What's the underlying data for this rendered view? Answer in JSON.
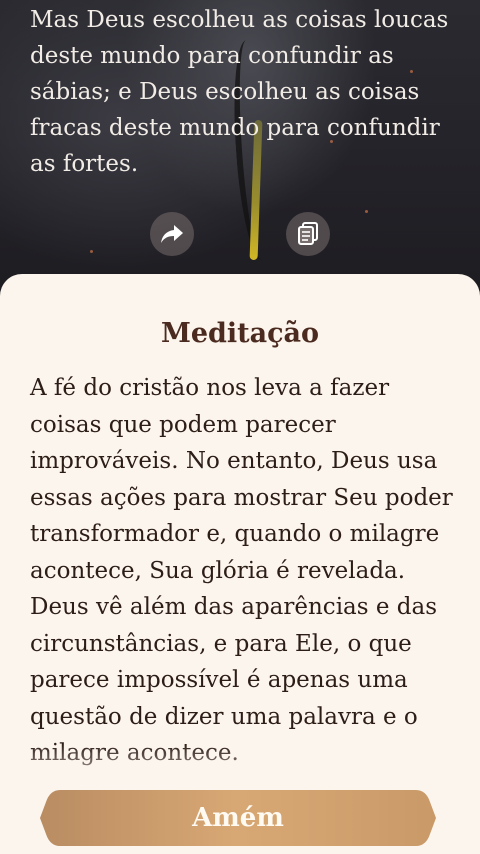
{
  "verse": {
    "text": "Mas Deus escolheu as coisas loucas deste mundo para confundir as sábias; e Deus escolheu as coisas fracas deste mundo para confundir as fortes."
  },
  "actions": {
    "share_icon": "share-arrow-icon",
    "copy_icon": "copy-icon"
  },
  "meditation": {
    "title": "Meditação",
    "body": "A fé do cristão nos leva a fazer coisas que podem parecer improváveis. No entanto, Deus usa essas ações para mostrar Seu poder transformador e, quando o milagre acontece, Sua glória é revelada. Deus vê além das aparências e das circunstâncias, e para Ele, o que parece impossível é apenas uma questão de dizer uma palavra e o milagre acontece."
  },
  "button": {
    "label": "Amém"
  },
  "colors": {
    "sheet_bg": "#fbf5ed",
    "title": "#4b2a1f",
    "text": "#2d1d17",
    "button_gold": "#d4a26b"
  }
}
